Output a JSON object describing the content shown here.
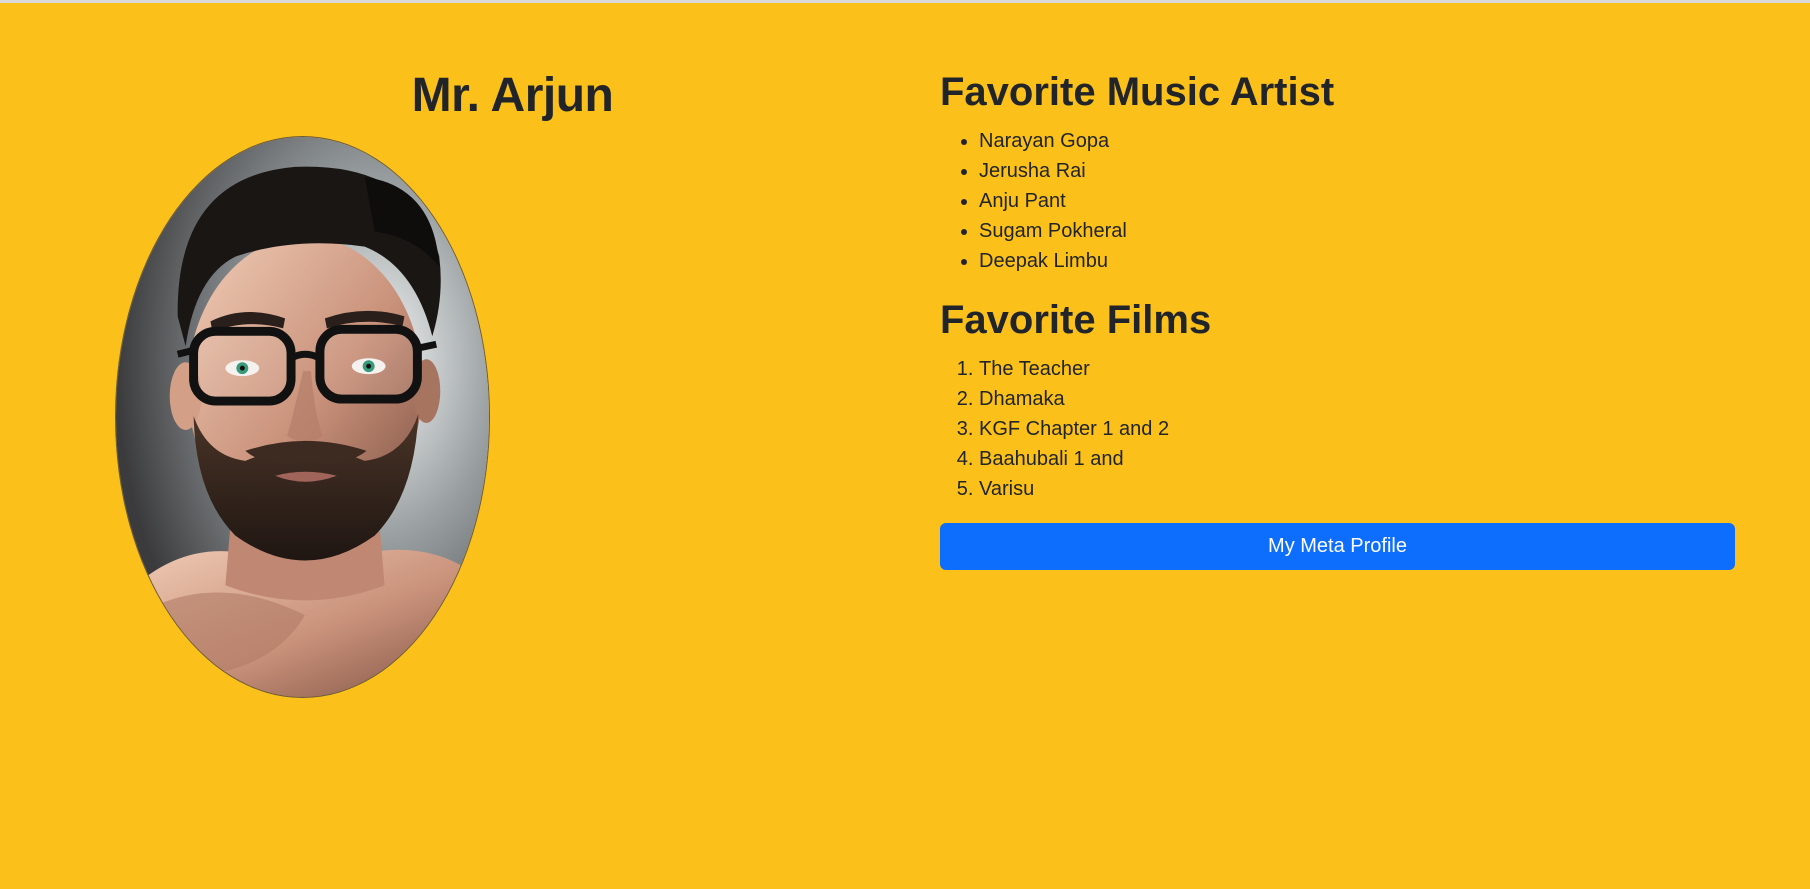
{
  "profile": {
    "name": "Mr. Arjun",
    "portrait_icon": "portrait-photo"
  },
  "music": {
    "heading": "Favorite Music Artist",
    "items": [
      "Narayan Gopa",
      "Jerusha Rai",
      "Anju Pant",
      "Sugam Pokheral",
      "Deepak Limbu"
    ]
  },
  "films": {
    "heading": "Favorite Films",
    "items": [
      "The Teacher",
      "Dhamaka",
      "KGF Chapter 1 and 2",
      "Baahubali 1 and",
      "Varisu"
    ]
  },
  "actions": {
    "meta_profile_label": "My Meta Profile"
  },
  "colors": {
    "background": "#fbc01a",
    "button": "#0d6efd",
    "text": "#212529"
  }
}
